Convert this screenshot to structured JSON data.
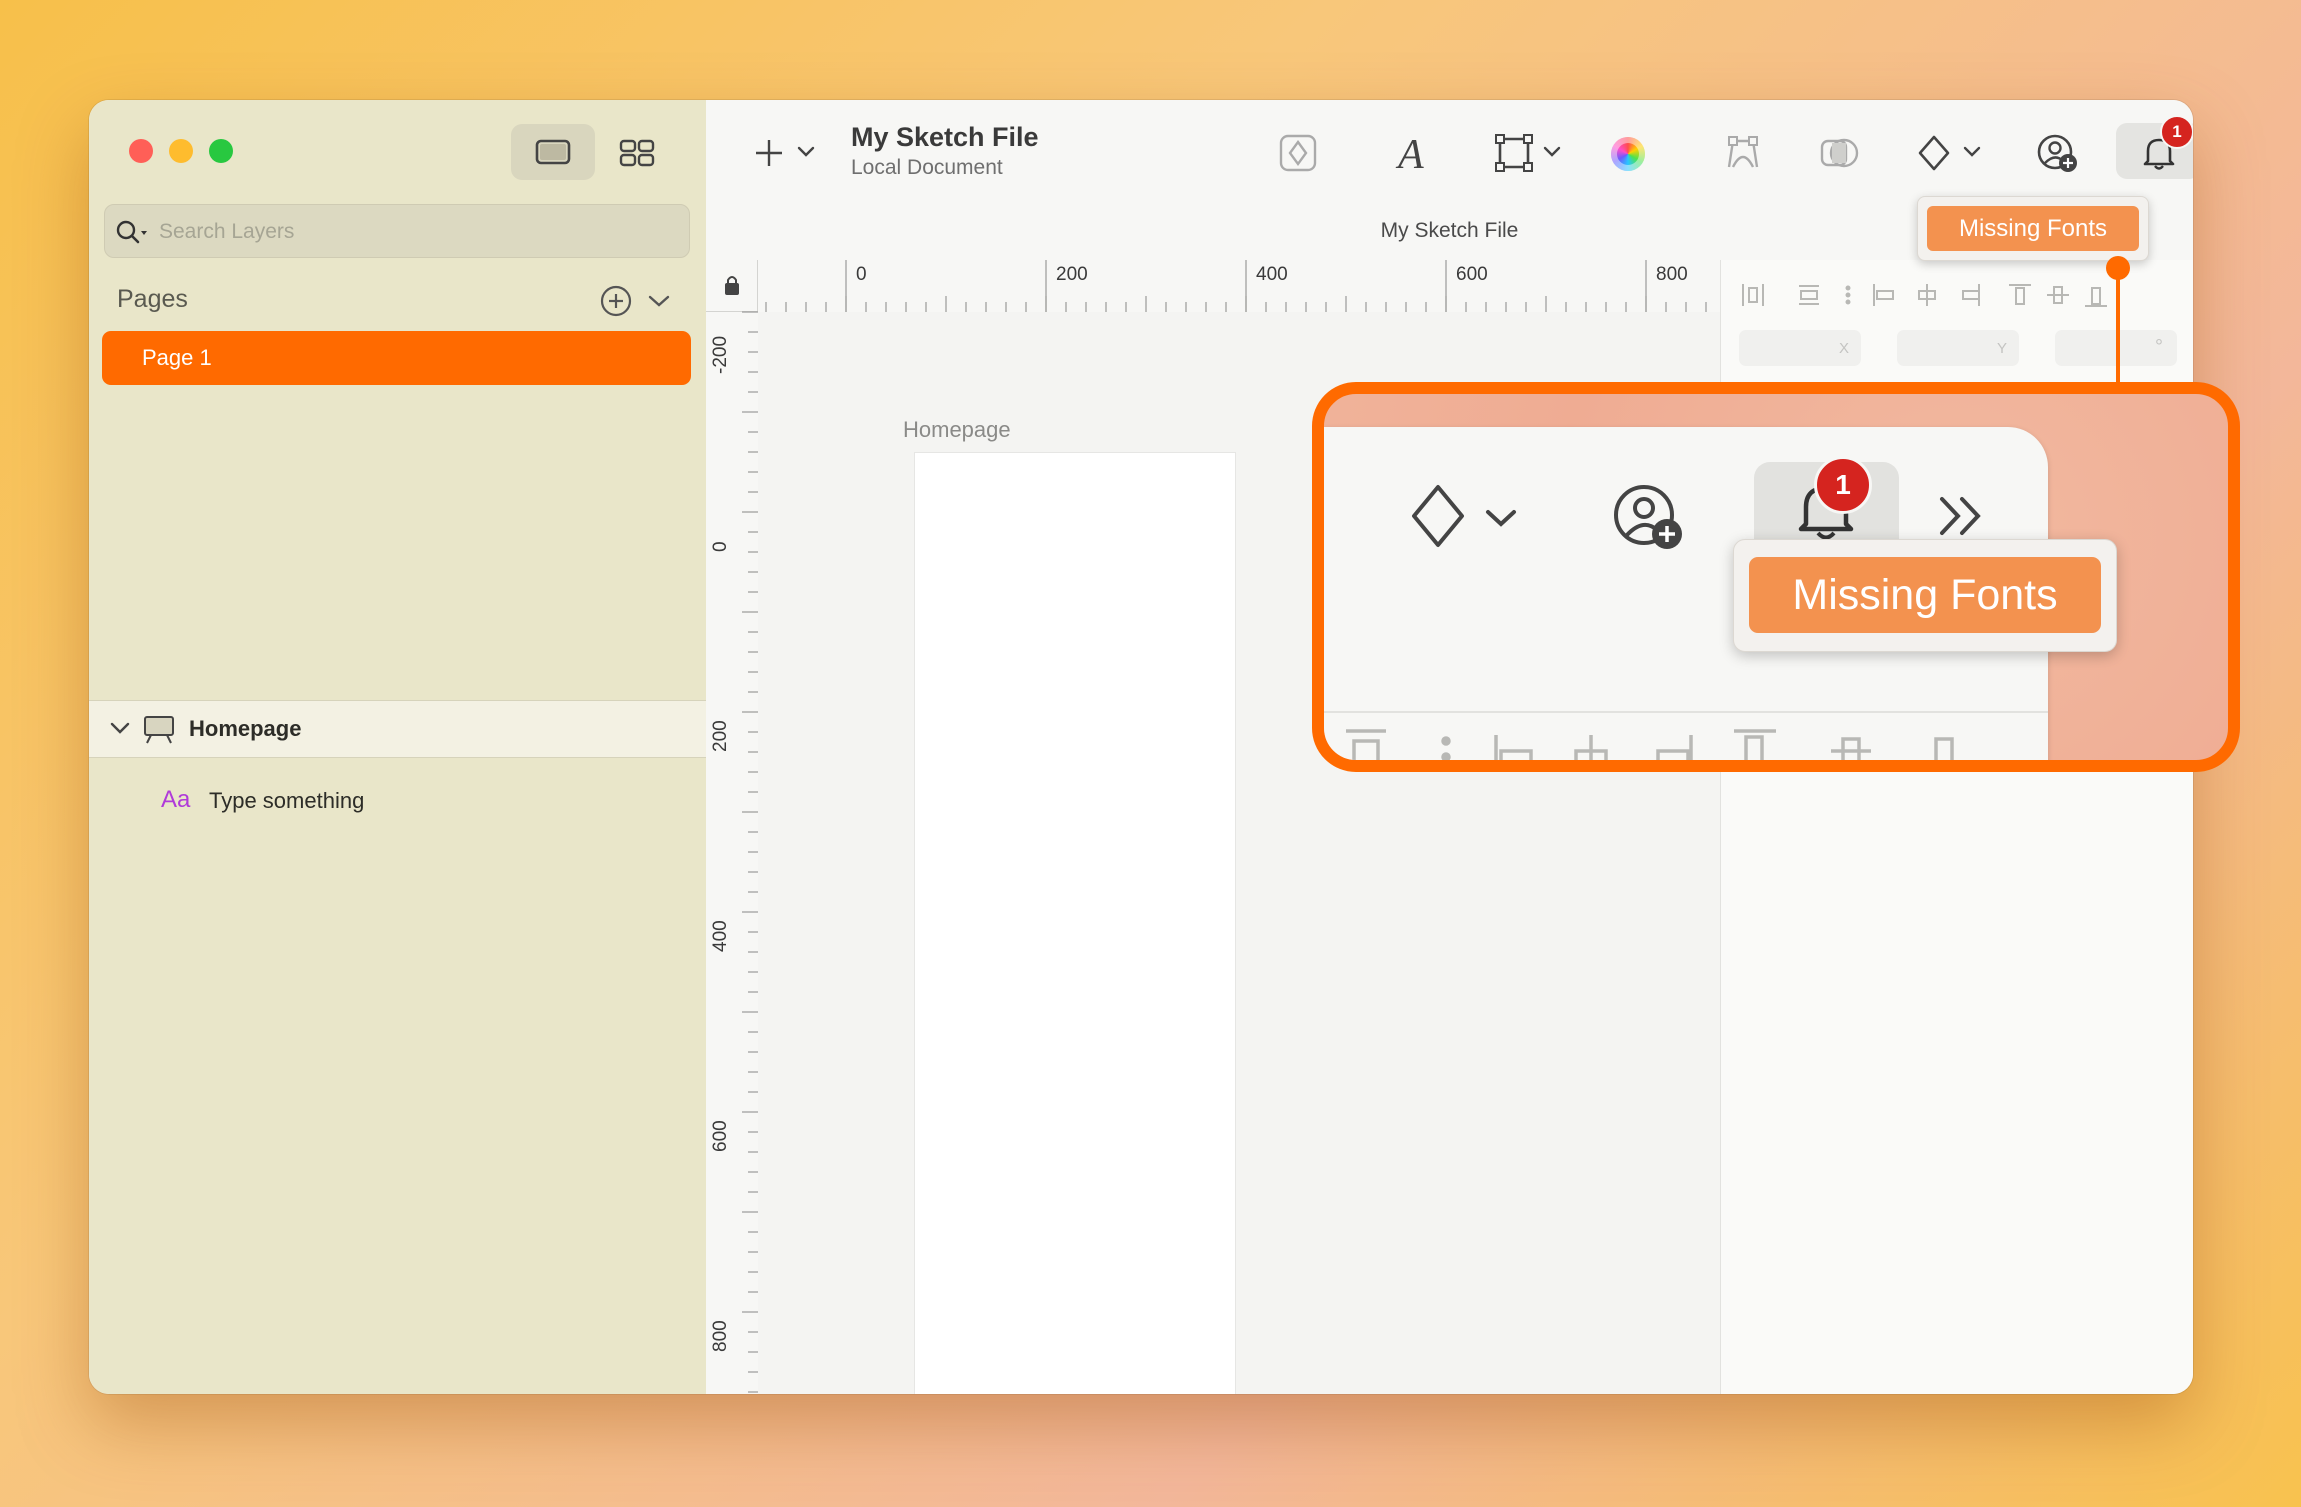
{
  "sidebar": {
    "search_placeholder": "Search Layers",
    "pages_label": "Pages",
    "pages": [
      {
        "label": "Page 1",
        "selected": true
      }
    ],
    "layers": {
      "artboard": "Homepage",
      "items": [
        {
          "icon": "text-layer-icon",
          "icon_text": "Aa",
          "label": "Type something"
        }
      ]
    }
  },
  "toolbar": {
    "doc_title": "My Sketch File",
    "doc_subtitle": "Local Document",
    "center_title": "My Sketch File",
    "notification_count": "1",
    "tooltip": "Missing Fonts"
  },
  "rulers": {
    "horizontal": [
      "0",
      "200",
      "400",
      "600",
      "800"
    ],
    "vertical": [
      "-200",
      "0",
      "200",
      "400",
      "600",
      "800"
    ]
  },
  "canvas": {
    "artboard_label": "Homepage"
  },
  "inspector": {
    "x_label": "X",
    "y_label": "Y",
    "rotation_label": "°"
  },
  "zoom": {
    "notification_count": "1",
    "tooltip": "Missing Fonts"
  },
  "colors": {
    "accent": "#ff6a00",
    "badge": "#d5241f",
    "tooltip": "#f3924f"
  }
}
